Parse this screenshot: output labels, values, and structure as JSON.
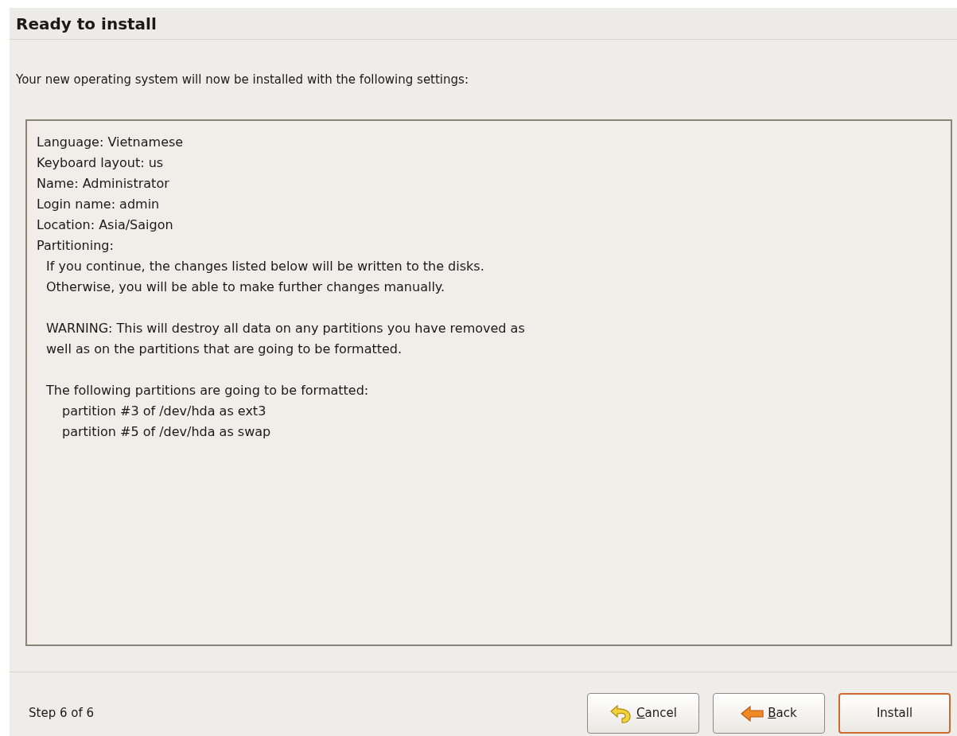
{
  "header": {
    "title": "Ready to install"
  },
  "intro": "Your new operating system will now be installed with the following settings:",
  "summary": {
    "lines": [
      "Language: Vietnamese",
      "Keyboard layout: us",
      "Name: Administrator",
      "Login name: admin",
      "Location: Asia/Saigon",
      "Partitioning:"
    ],
    "paragraphs": [
      {
        "lines": [
          "If you continue, the changes listed below will be written to the disks.",
          "Otherwise, you will be able to make further changes manually."
        ]
      },
      {
        "lines": [
          "WARNING: This will destroy all data on any partitions you have removed as",
          "well as on the partitions that are going to be formatted."
        ]
      },
      {
        "lines": [
          "The following partitions are going to be formatted:"
        ],
        "children": [
          "partition #3 of /dev/hda as ext3",
          "partition #5 of /dev/hda as swap"
        ]
      }
    ]
  },
  "footer": {
    "step": "Step 6 of 6",
    "buttons": [
      {
        "kind": "cancel",
        "label": "Cancel",
        "mnemonic": true,
        "default": false
      },
      {
        "kind": "back",
        "label": "Back",
        "mnemonic": true,
        "default": false
      },
      {
        "kind": "plain",
        "label": "Install",
        "mnemonic": false,
        "default": true
      }
    ]
  }
}
